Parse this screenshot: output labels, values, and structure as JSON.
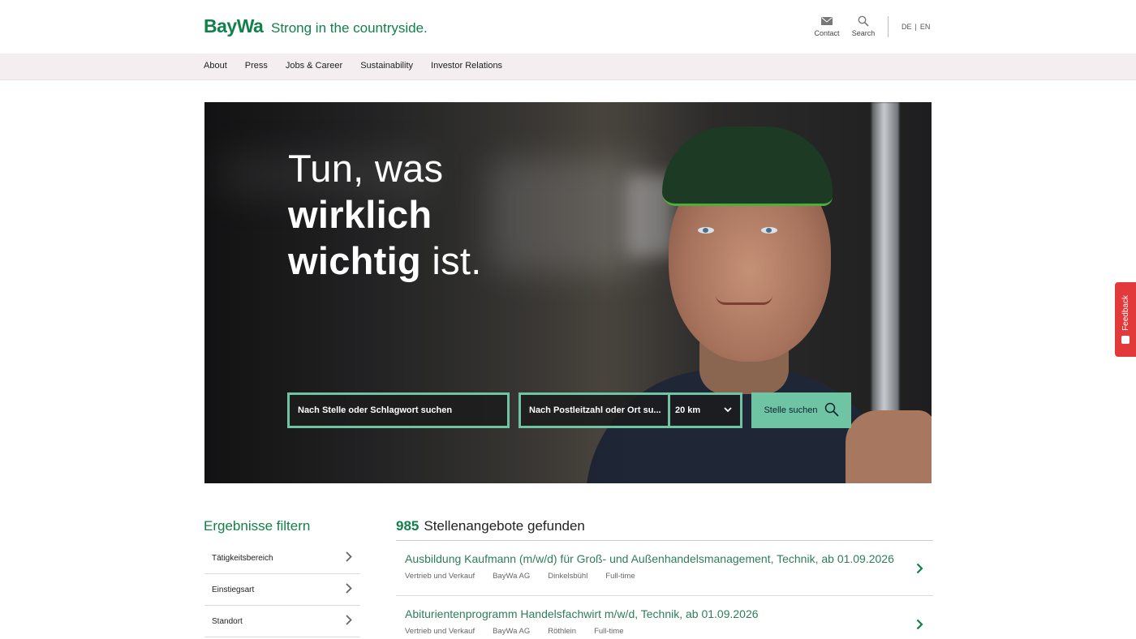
{
  "header": {
    "logo": "BayWa",
    "tagline": "Strong in the countryside.",
    "contact_label": "Contact",
    "search_label": "Search",
    "lang_de": "DE",
    "lang_sep": "|",
    "lang_en": "EN",
    "brand_color": "#12804a"
  },
  "nav": {
    "items": [
      {
        "label": "About"
      },
      {
        "label": "Press"
      },
      {
        "label": "Jobs & Career"
      },
      {
        "label": "Sustainability"
      },
      {
        "label": "Investor Relations"
      }
    ]
  },
  "hero": {
    "line1": "Tun, was",
    "line2": "wirklich",
    "line3_bold": "wichtig",
    "line3_rest": " ist.",
    "keyword_placeholder": "Nach Stelle oder Schlagwort suchen",
    "location_placeholder": "Nach Postleitzahl oder Ort su...",
    "radius_value": "20 km",
    "search_button": "Stelle suchen",
    "accent_color": "#6ec4a3"
  },
  "feedback": {
    "label": "Feedback"
  },
  "filters": {
    "title": "Ergebnisse filtern",
    "items": [
      {
        "label": "Tätigkeitsbereich"
      },
      {
        "label": "Einstiegsart"
      },
      {
        "label": "Standort"
      }
    ]
  },
  "results": {
    "count": "985",
    "count_label": "Stellenangebote gefunden",
    "jobs": [
      {
        "title": "Ausbildung Kaufmann (m/w/d) für Groß- und Außenhandelsmanagement, Technik, ab 01.09.2026",
        "area": "Vertrieb und Verkauf",
        "company": "BayWa AG",
        "location": "Dinkelsbühl",
        "type": "Full-time"
      },
      {
        "title": "Abiturientenprogramm Handelsfachwirt m/w/d, Technik, ab 01.09.2026",
        "area": "Vertrieb und Verkauf",
        "company": "BayWa AG",
        "location": "Röthlein",
        "type": "Full-time"
      }
    ]
  }
}
